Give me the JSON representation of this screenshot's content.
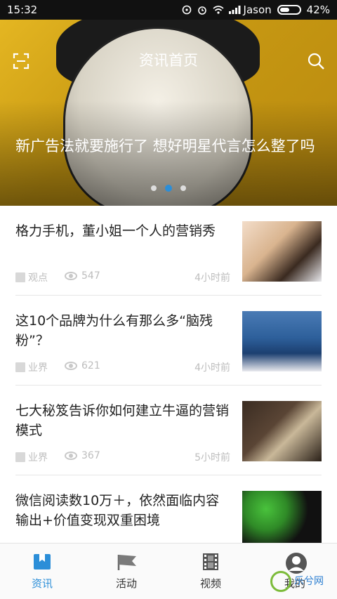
{
  "status_bar": {
    "time": "15:32",
    "carrier": "Jason",
    "battery": "42%"
  },
  "header": {
    "title": "资讯首页",
    "scan_icon": "scan-icon",
    "search_icon": "search-icon"
  },
  "hero": {
    "headline": "新广告法就要施行了 想好明星代言怎么整了吗",
    "active_dot": 2,
    "dot_count": 3
  },
  "feed": {
    "items": [
      {
        "title": "格力手机，董小姐一个人的营销秀",
        "category": "观点",
        "views": "547",
        "time": "4小时前"
      },
      {
        "title": "这10个品牌为什么有那么多“脑残粉”？",
        "category": "业界",
        "views": "621",
        "time": "4小时前"
      },
      {
        "title": "七大秘笈告诉你如何建立牛逼的营销模式",
        "category": "业界",
        "views": "367",
        "time": "5小时前"
      },
      {
        "title": "微信阅读数10万＋，依然面临内容输出+价值变现双重困境",
        "category": "",
        "views": "",
        "time": ""
      }
    ]
  },
  "bottom_nav": {
    "tabs": [
      {
        "label": "资讯",
        "icon": "news-icon",
        "active": true
      },
      {
        "label": "活动",
        "icon": "flag-icon",
        "active": false
      },
      {
        "label": "视频",
        "icon": "film-icon",
        "active": false
      },
      {
        "label": "我的",
        "icon": "user-icon",
        "active": false
      }
    ]
  },
  "watermark": {
    "text": "乐兮网"
  },
  "colors": {
    "accent": "#2b8ed8",
    "meta_gray": "#bdbdbd"
  }
}
